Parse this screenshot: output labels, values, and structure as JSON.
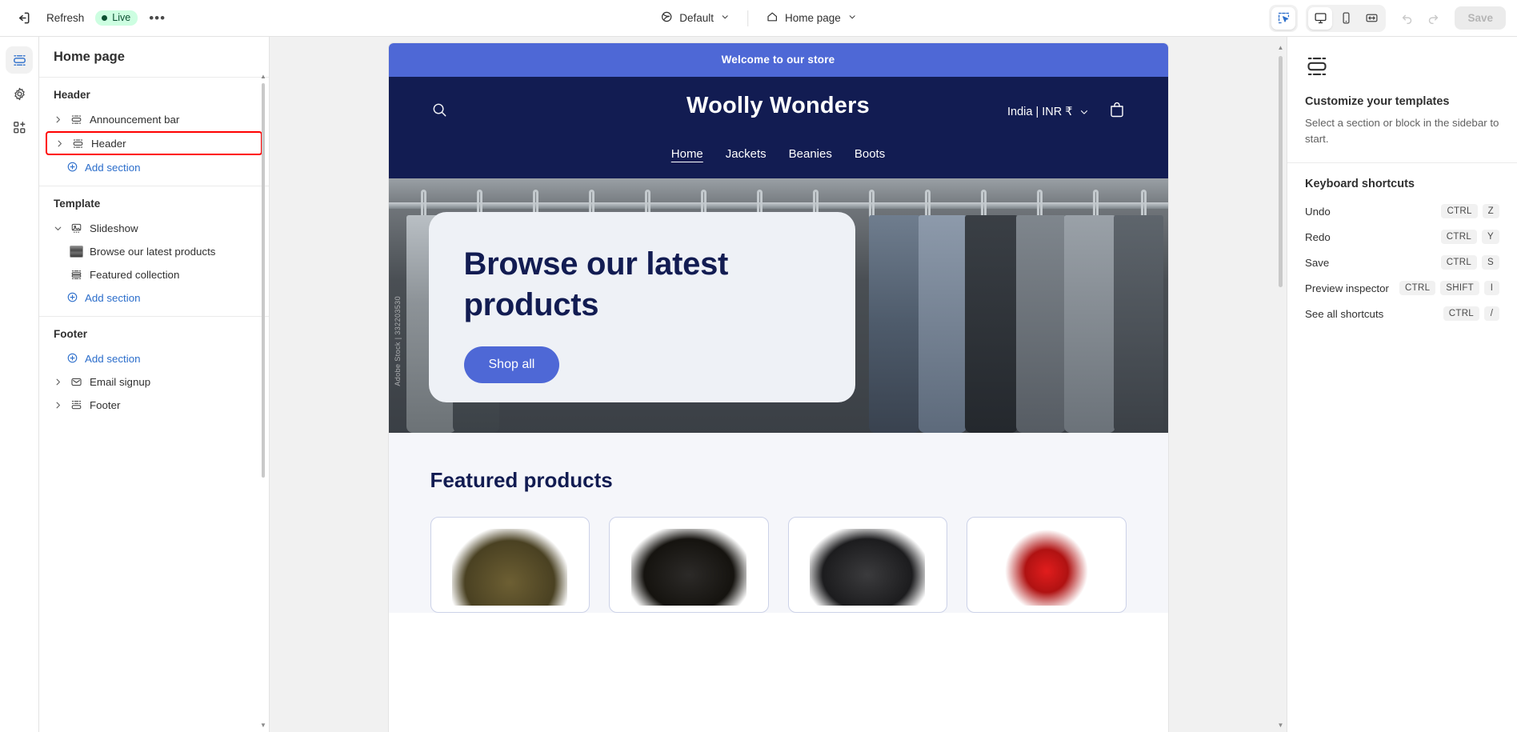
{
  "topbar": {
    "exit_icon": "exit-icon",
    "refresh_label": "Refresh",
    "live_label": "Live",
    "more_label": "•••",
    "theme_selector": {
      "icon": "globe-icon",
      "label": "Default",
      "chevron": "chevron-down-icon"
    },
    "page_selector": {
      "icon": "home-icon",
      "label": "Home page",
      "chevron": "chevron-down-icon"
    },
    "view_modes": [
      {
        "name": "inspector-toggle",
        "icon": "select-cursor-icon",
        "active": true
      },
      {
        "name": "desktop-view",
        "icon": "desktop-icon",
        "active": true
      },
      {
        "name": "mobile-view",
        "icon": "mobile-icon",
        "active": false
      },
      {
        "name": "fullwidth-view",
        "icon": "fullwidth-icon",
        "active": false
      }
    ],
    "undo_icon": "undo-icon",
    "redo_icon": "redo-icon",
    "save_label": "Save"
  },
  "rail": {
    "items": [
      {
        "name": "sections-icon",
        "active": true
      },
      {
        "name": "theme-settings-gear-icon",
        "active": false
      },
      {
        "name": "apps-blocks-icon",
        "active": false
      }
    ]
  },
  "sidebar": {
    "title": "Home page",
    "groups": [
      {
        "label": "Header",
        "rows": [
          {
            "label": "Announcement bar",
            "icon": "section-icon",
            "caret": "chevron-right-icon",
            "highlight": false
          },
          {
            "label": "Header",
            "icon": "section-icon",
            "caret": "chevron-right-icon",
            "highlight": true
          }
        ],
        "add_label": "Add section"
      },
      {
        "label": "Template",
        "rows": [
          {
            "label": "Slideshow",
            "icon": "slideshow-icon",
            "caret": "chevron-down-icon",
            "highlight": false
          },
          {
            "label": "Browse our latest products",
            "icon": "image-thumbnail",
            "caret": "",
            "highlight": false,
            "child": true
          },
          {
            "label": "Featured collection",
            "icon": "collection-icon",
            "caret": "",
            "highlight": false
          }
        ],
        "add_label": "Add section"
      },
      {
        "label": "Footer",
        "add_label_first": "Add section",
        "rows": [
          {
            "label": "Email signup",
            "icon": "envelope-icon",
            "caret": "chevron-right-icon",
            "highlight": false
          },
          {
            "label": "Footer",
            "icon": "footer-icon",
            "caret": "chevron-right-icon",
            "highlight": false
          }
        ]
      }
    ]
  },
  "preview": {
    "announcement": "Welcome to our store",
    "store_name": "Woolly Wonders",
    "search_icon": "search-icon",
    "country_currency": "India | INR ₹",
    "cart_icon": "shopping-bag-icon",
    "nav": [
      {
        "label": "Home",
        "current": true
      },
      {
        "label": "Jackets",
        "current": false
      },
      {
        "label": "Beanies",
        "current": false
      },
      {
        "label": "Boots",
        "current": false
      }
    ],
    "hero": {
      "title": "Browse our latest products",
      "cta": "Shop all",
      "watermark": "Adobe Stock | 332203530"
    },
    "featured_title": "Featured products",
    "products": [
      {
        "name": "boots-product-card"
      },
      {
        "name": "leopard-jacket-product-card"
      },
      {
        "name": "black-jacket-product-card"
      },
      {
        "name": "red-pompom-beanie-product-card"
      }
    ]
  },
  "right_panel": {
    "icon": "section-block-icon",
    "heading": "Customize your templates",
    "subtext": "Select a section or block in the sidebar to start.",
    "shortcuts_title": "Keyboard shortcuts",
    "shortcuts": [
      {
        "label": "Undo",
        "keys": [
          "CTRL",
          "Z"
        ]
      },
      {
        "label": "Redo",
        "keys": [
          "CTRL",
          "Y"
        ]
      },
      {
        "label": "Save",
        "keys": [
          "CTRL",
          "S"
        ]
      },
      {
        "label": "Preview inspector",
        "keys": [
          "CTRL",
          "SHIFT",
          "I"
        ]
      },
      {
        "label": "See all shortcuts",
        "keys": [
          "CTRL",
          "/"
        ]
      }
    ]
  },
  "colors": {
    "accent_blue": "#2c6ecb",
    "announce_blue": "#4e68d6",
    "store_navy": "#121c52",
    "live_green_bg": "#cdfee1",
    "live_green_fg": "#0c5132",
    "highlight_red": "#ff0000"
  }
}
